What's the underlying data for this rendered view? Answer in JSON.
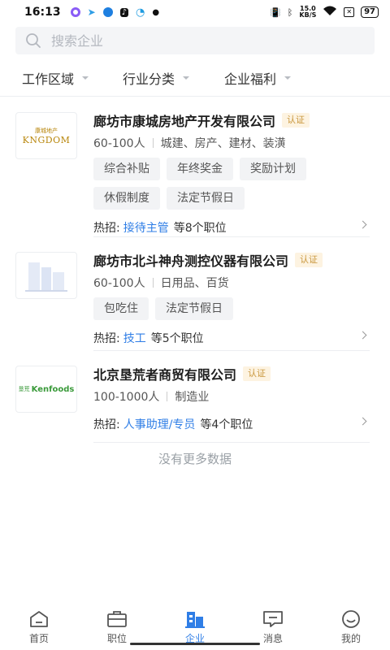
{
  "status": {
    "time": "16:13",
    "battery": "97",
    "net_speed_value": "15.0",
    "net_speed_unit": "KB/S"
  },
  "search": {
    "placeholder": "搜索企业"
  },
  "filters": [
    {
      "label": "工作区域"
    },
    {
      "label": "行业分类"
    },
    {
      "label": "企业福利"
    }
  ],
  "companies": [
    {
      "name": "廊坊市康城房地产开发有限公司",
      "badge": "认证",
      "size": "60-100人",
      "industry": "城建、房产、建材、装潢",
      "tags": [
        "综合补贴",
        "年终奖金",
        "奖励计划",
        "休假制度",
        "法定节假日"
      ],
      "hot_label": "热招:",
      "hot_job": "接待主管",
      "hot_suffix": "等8个职位",
      "logo_text_top": "康城地产",
      "logo_text_main": "KNGDOM"
    },
    {
      "name": "廊坊市北斗神舟测控仪器有限公司",
      "badge": "认证",
      "size": "60-100人",
      "industry": "日用品、百货",
      "tags": [
        "包吃住",
        "法定节假日"
      ],
      "hot_label": "热招:",
      "hot_job": "技工",
      "hot_suffix": "等5个职位"
    },
    {
      "name": "北京垦荒者商贸有限公司",
      "badge": "认证",
      "size": "100-1000人",
      "industry": "制造业",
      "tags": [],
      "hot_label": "热招:",
      "hot_job": "人事助理/专员",
      "hot_suffix": "等4个职位",
      "logo_text_top": "垦荒",
      "logo_text_main": "Kenfoods"
    }
  ],
  "no_more_text": "没有更多数据",
  "nav": [
    {
      "label": "首页",
      "icon": "home-icon"
    },
    {
      "label": "职位",
      "icon": "briefcase-icon"
    },
    {
      "label": "企业",
      "icon": "building-icon",
      "active": true
    },
    {
      "label": "消息",
      "icon": "message-icon"
    },
    {
      "label": "我的",
      "icon": "profile-icon"
    }
  ],
  "colors": {
    "accent": "#2f7ee6",
    "badge_bg": "#fdf3e1",
    "badge_text": "#c9973d"
  }
}
